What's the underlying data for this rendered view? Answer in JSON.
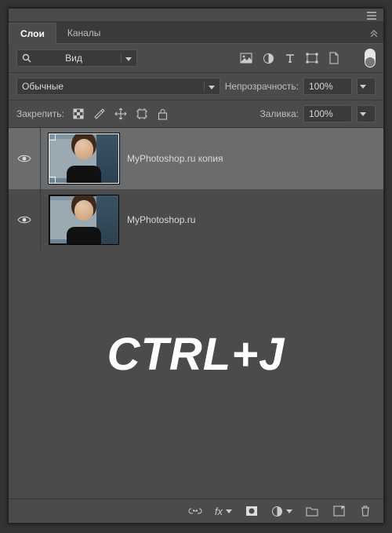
{
  "tabs": {
    "layers": "Слои",
    "channels": "Каналы"
  },
  "filter": {
    "search_label": "Вид",
    "icons": [
      "image-filter",
      "adjustment-filter",
      "type-filter",
      "shape-filter",
      "smartobj-filter"
    ]
  },
  "blend": {
    "mode": "Обычные",
    "opacity_label": "Непрозрачность:",
    "opacity_value": "100%"
  },
  "lock": {
    "label": "Закрепить:",
    "fill_label": "Заливка:",
    "fill_value": "100%"
  },
  "layers": [
    {
      "name": "MyPhotoshop.ru копия",
      "visible": true,
      "selected": true
    },
    {
      "name": "MyPhotoshop.ru",
      "visible": true,
      "selected": false
    }
  ],
  "overlay_text": "CTRL+J",
  "footer_icons": [
    "link-icon",
    "fx-icon",
    "mask-icon",
    "adjustment-icon",
    "group-icon",
    "new-layer-icon",
    "trash-icon"
  ]
}
